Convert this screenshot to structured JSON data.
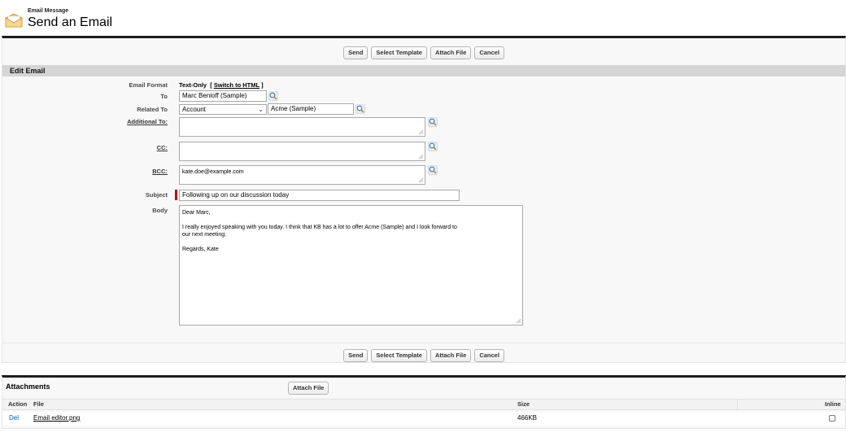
{
  "header": {
    "object_type": "Email Message",
    "title": "Send an Email"
  },
  "buttons": {
    "send": "Send",
    "select_template": "Select Template",
    "attach_file": "Attach File",
    "cancel": "Cancel"
  },
  "section_title": "Edit Email",
  "form": {
    "email_format": {
      "label": "Email Format",
      "value": "Text-Only",
      "bracket_open": "[",
      "switch_link": "Switch to HTML",
      "bracket_close": "]"
    },
    "to": {
      "label": "To",
      "value": "Marc Benioff (Sample)"
    },
    "related_to": {
      "label": "Related To",
      "type_value": "Account",
      "record_value": "Acme (Sample)"
    },
    "additional_to": {
      "label": "Additional To:",
      "value": ""
    },
    "cc": {
      "label": "CC:",
      "value": ""
    },
    "bcc": {
      "label": "BCC:",
      "value": "kate.doe@example.com"
    },
    "subject": {
      "label": "Subject",
      "value": "Following up on our discussion today"
    },
    "body": {
      "label": "Body",
      "line1": "Dear Marc,",
      "line2": "I really enjoyed speaking with you today.  I think that KB has a lot to offer Acme (Sample) and I look forward to",
      "line3": "our next meeting.",
      "line4": "Regards,  Kate"
    }
  },
  "attachments": {
    "title": "Attachments",
    "attach_button": "Attach File",
    "columns": {
      "action": "Action",
      "file": "File",
      "size": "Size",
      "inline": "Inline"
    },
    "rows": [
      {
        "action": "Del",
        "file": "Email editor.png",
        "size": "466KB",
        "inline": false
      }
    ]
  },
  "icons": {
    "header": "envelope-icon",
    "lookup": "lookup-magnifier-icon"
  },
  "colors": {
    "required": "#cc0000",
    "link": "#015ba7",
    "section_bar": "#d5d5d5",
    "top_border": "#1d1d1d"
  }
}
